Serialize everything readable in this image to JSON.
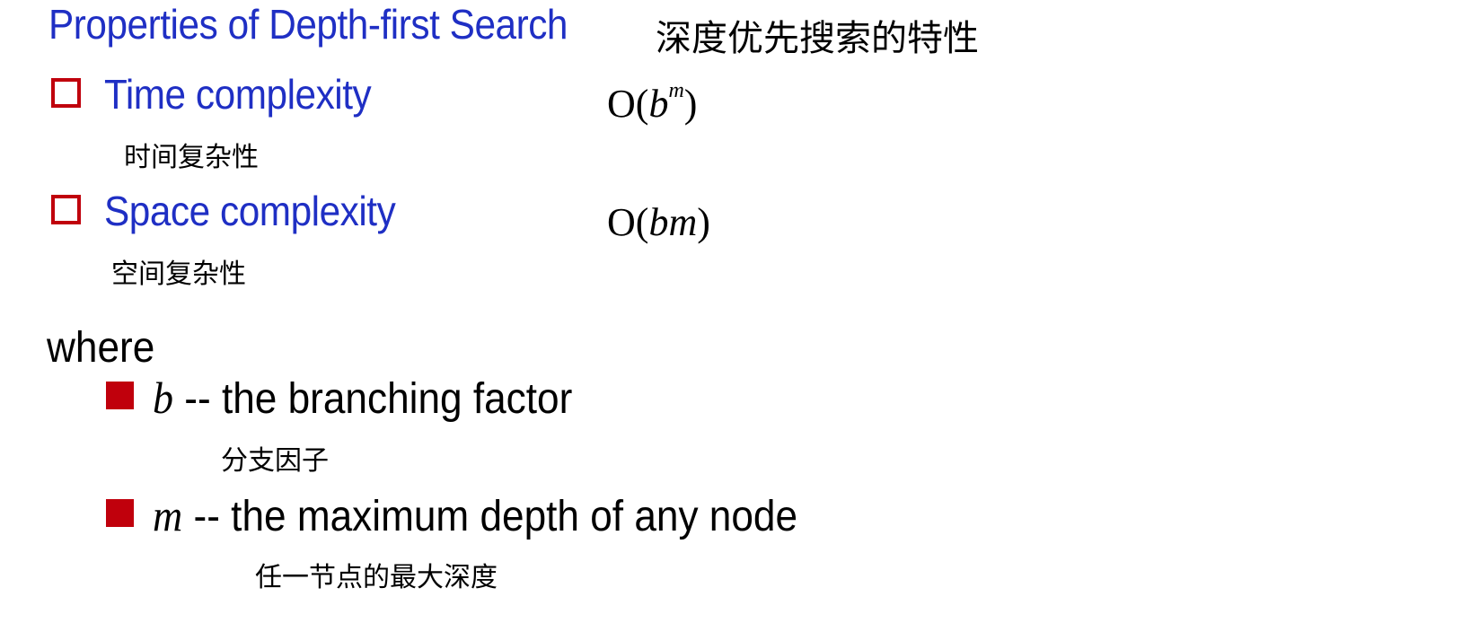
{
  "title": {
    "en": "Properties of Depth-first Search",
    "cn": "深度优先搜索的特性"
  },
  "properties": [
    {
      "label": "Time complexity",
      "cn": "时间复杂性",
      "complexity_prefix": "O(",
      "complexity_base": "b",
      "complexity_exp": "m",
      "complexity_suffix": ")"
    },
    {
      "label": "Space complexity",
      "cn": "空间复杂性",
      "complexity_prefix": "O(",
      "complexity_base": "bm",
      "complexity_suffix": ")"
    }
  ],
  "where": "where",
  "variables": [
    {
      "symbol": "b",
      "description": " -- the branching factor",
      "cn": "分支因子"
    },
    {
      "symbol": "m",
      "description": " -- the maximum depth of any node",
      "cn": "任一节点的最大深度"
    }
  ],
  "colors": {
    "heading_blue": "#1f2fc4",
    "bullet_red": "#c0000c"
  }
}
